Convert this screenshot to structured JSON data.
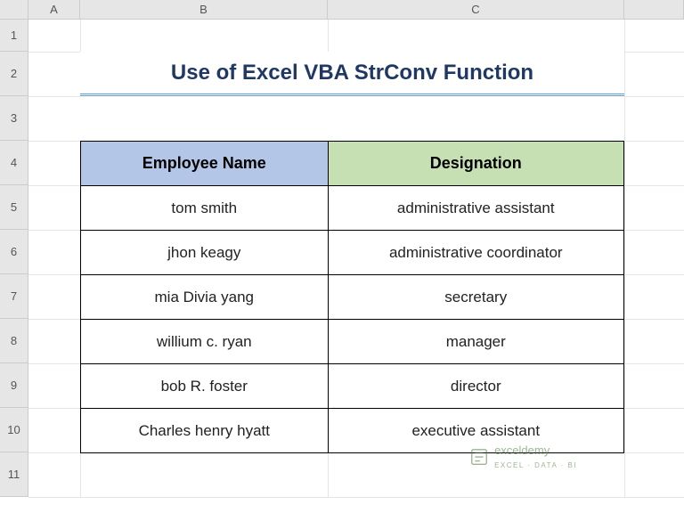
{
  "columns": [
    "A",
    "B",
    "C"
  ],
  "rows": [
    "1",
    "2",
    "3",
    "4",
    "5",
    "6",
    "7",
    "8",
    "9",
    "10",
    "11"
  ],
  "title": "Use of Excel VBA StrConv Function",
  "headers": {
    "col1": "Employee Name",
    "col2": "Designation"
  },
  "data": [
    {
      "name": "tom smith",
      "desig": "administrative assistant"
    },
    {
      "name": "jhon keagy",
      "desig": "administrative coordinator"
    },
    {
      "name": "mia Divia yang",
      "desig": "secretary"
    },
    {
      "name": "willium c. ryan",
      "desig": "manager"
    },
    {
      "name": "bob R. foster",
      "desig": "director"
    },
    {
      "name": "Charles henry hyatt",
      "desig": "executive assistant"
    }
  ],
  "watermark": {
    "brand": "exceldemy",
    "tagline": "EXCEL · DATA · BI"
  }
}
